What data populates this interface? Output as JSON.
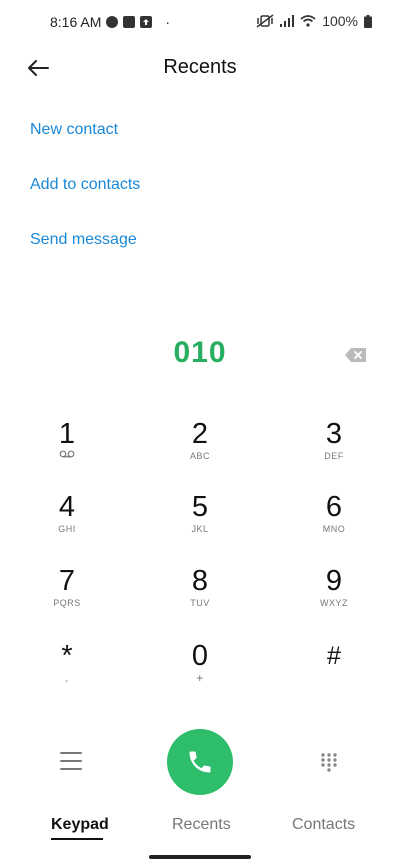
{
  "status_bar": {
    "time": "8:16 AM",
    "dot": "·",
    "battery_percent": "100%"
  },
  "header": {
    "title": "Recents"
  },
  "options": {
    "new_contact": "New contact",
    "add_to_contacts": "Add to contacts",
    "send_message": "Send message"
  },
  "dial": {
    "number": "010"
  },
  "keypad": {
    "keys": [
      {
        "digit": "1",
        "letters": ""
      },
      {
        "digit": "2",
        "letters": "ABC"
      },
      {
        "digit": "3",
        "letters": "DEF"
      },
      {
        "digit": "4",
        "letters": "GHI"
      },
      {
        "digit": "5",
        "letters": "JKL"
      },
      {
        "digit": "6",
        "letters": "MNO"
      },
      {
        "digit": "7",
        "letters": "PQRS"
      },
      {
        "digit": "8",
        "letters": "TUV"
      },
      {
        "digit": "9",
        "letters": "WXYZ"
      },
      {
        "digit": "*",
        "letters": ","
      },
      {
        "digit": "0",
        "letters": "+"
      },
      {
        "digit": "#",
        "letters": ""
      }
    ]
  },
  "tabs": [
    {
      "label": "Keypad",
      "active": true
    },
    {
      "label": "Recents",
      "active": false
    },
    {
      "label": "Contacts",
      "active": false
    }
  ],
  "colors": {
    "accent_blue": "#1a88d8",
    "number_green": "#27ae60",
    "call_green": "#2ebd6b"
  },
  "icons": {
    "back": "arrow-left-icon",
    "backspace": "backspace-icon",
    "call": "phone-icon",
    "menu": "menu-icon",
    "dialpad": "dialpad-icon",
    "voicemail": "voicemail-icon"
  }
}
